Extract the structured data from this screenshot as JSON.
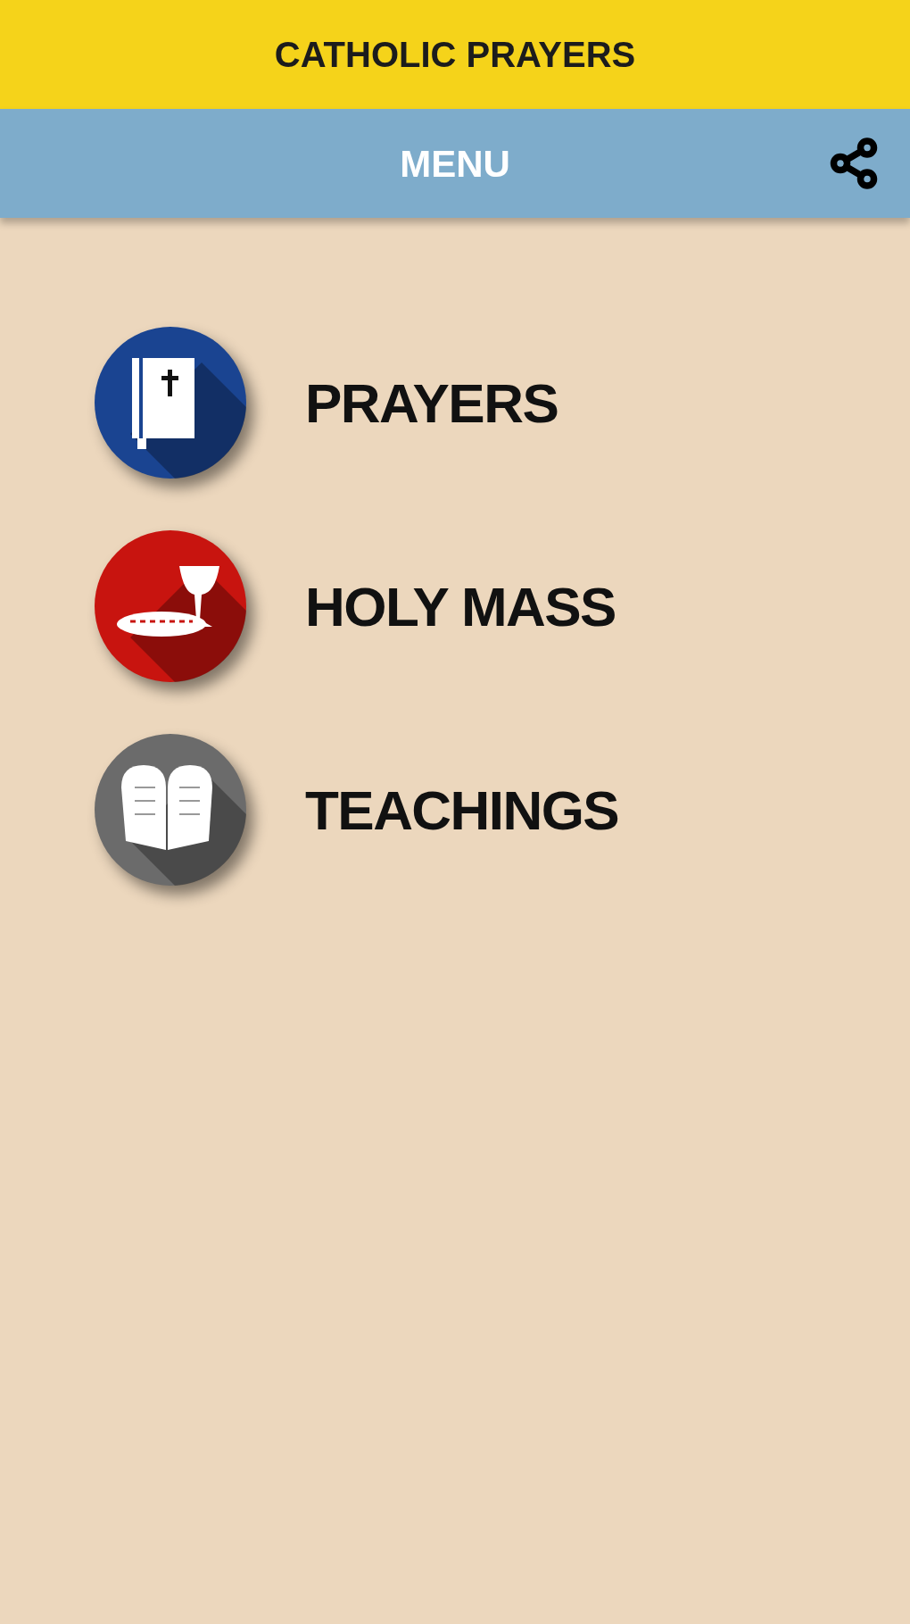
{
  "app_bar": {
    "title": "CATHOLIC PRAYERS"
  },
  "toolbar": {
    "title": "MENU"
  },
  "menu_items": [
    {
      "label": "PRAYERS",
      "kind": "book",
      "color": "#1a4491"
    },
    {
      "label": "HOLY MASS",
      "kind": "chalice",
      "color": "#c8140f"
    },
    {
      "label": "TEACHINGS",
      "kind": "tablets",
      "color": "#6b6b6b"
    }
  ]
}
